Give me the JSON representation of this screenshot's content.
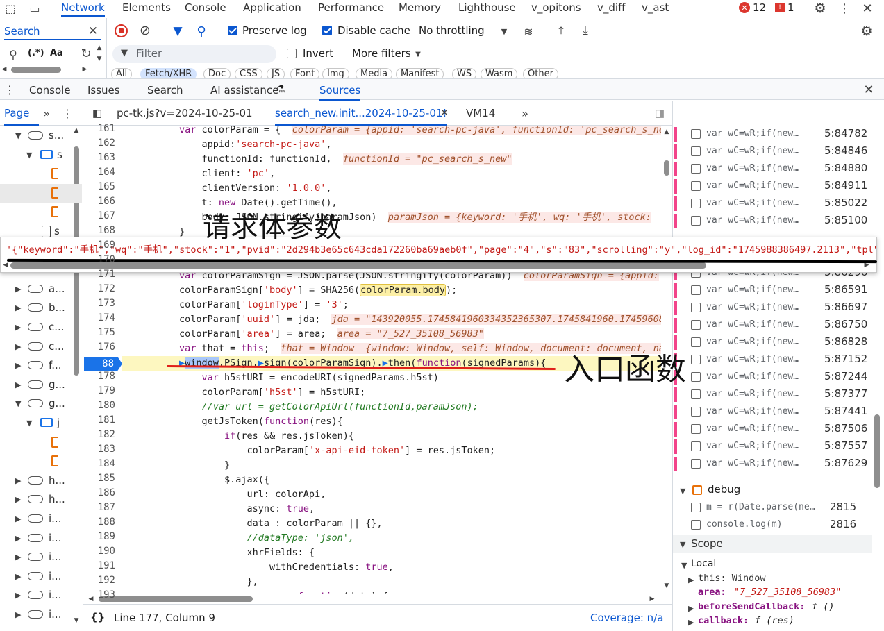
{
  "top_tabs": [
    "Network",
    "Elements",
    "Console",
    "Application",
    "Performance",
    "Memory",
    "Lighthouse",
    "v_opitons",
    "v_diff",
    "v_ast"
  ],
  "top_active": "Network",
  "error_count": "12",
  "warning_count": "1",
  "search_tab": "Search",
  "regex_label": "(.*)",
  "case_label": "Aa",
  "network": {
    "preserve_log": "Preserve log",
    "disable_cache": "Disable cache",
    "throttling": "No throttling",
    "filter_placeholder": "Filter",
    "invert": "Invert",
    "more_filters": "More filters",
    "pills": [
      "All",
      "Fetch/XHR",
      "Doc",
      "CSS",
      "JS",
      "Font",
      "Img",
      "Media",
      "Manifest",
      "WS",
      "Wasm",
      "Other"
    ]
  },
  "drawer_tabs": [
    "Console",
    "Issues",
    "Search",
    "AI assistance",
    "Sources"
  ],
  "drawer_active": "Sources",
  "nav_label": "Page",
  "file_tabs": [
    "pc-tk.js?v=2024-10-25-01",
    "search_new.init...2024-10-25-01!",
    "VM14"
  ],
  "file_active": "search_new.init...2024-10-25-01!",
  "nav_items": [
    {
      "label": "s...",
      "kind": "cloud",
      "open": true
    },
    {
      "label": "s",
      "kind": "folder",
      "open": true
    },
    {
      "label": "",
      "kind": "file"
    },
    {
      "label": "",
      "kind": "file"
    },
    {
      "label": "",
      "kind": "file"
    },
    {
      "label": "s",
      "kind": "page"
    },
    {
      "label": "",
      "kind": "hidden"
    },
    {
      "label": "",
      "kind": "hidden"
    },
    {
      "label": "a...",
      "kind": "cloud"
    },
    {
      "label": "b...",
      "kind": "cloud"
    },
    {
      "label": "c...",
      "kind": "cloud"
    },
    {
      "label": "c...",
      "kind": "cloud"
    },
    {
      "label": "f...",
      "kind": "cloud"
    },
    {
      "label": "g...",
      "kind": "cloud"
    },
    {
      "label": "g...",
      "kind": "cloud",
      "open": true
    },
    {
      "label": "j",
      "kind": "folder",
      "open": true
    },
    {
      "label": "",
      "kind": "file"
    },
    {
      "label": "",
      "kind": "file"
    },
    {
      "label": "h...",
      "kind": "cloud"
    },
    {
      "label": "h...",
      "kind": "cloud"
    },
    {
      "label": "i...",
      "kind": "cloud"
    },
    {
      "label": "i...",
      "kind": "cloud"
    },
    {
      "label": "i...",
      "kind": "cloud"
    },
    {
      "label": "i...",
      "kind": "cloud"
    },
    {
      "label": "i...",
      "kind": "cloud"
    },
    {
      "label": "i...",
      "kind": "cloud"
    }
  ],
  "code_lines": [
    {
      "num": "161",
      "html": "<span class=\"kw\">var</span> colorParam = {  <span class=\"inl\">colorParam = {appid: 'search-pc-java', functionId: 'pc_search_s_ne</span>"
    },
    {
      "num": "162",
      "html": "    appid:<span class=\"str\">'search-pc-java'</span>,"
    },
    {
      "num": "163",
      "html": "    functionId: functionId,  <span class=\"inl\">functionId = \"pc_search_s_new\"</span>"
    },
    {
      "num": "164",
      "html": "    client: <span class=\"str\">'pc'</span>,"
    },
    {
      "num": "165",
      "html": "    clientVersion: <span class=\"str\">'1.0.0'</span>,"
    },
    {
      "num": "166",
      "html": "    t: <span class=\"kw\">new</span> Date().getTime(),"
    },
    {
      "num": "167",
      "html": "    body: JSON.stringify(paramJson)  <span class=\"inl\">paramJson = {keyword: '手机', wq: '手机', stock:</span>"
    },
    {
      "num": "168",
      "html": "}"
    },
    {
      "num": "169",
      "html": ""
    },
    {
      "num": "170",
      "html": ""
    },
    {
      "num": "171",
      "html": "<span class=\"kw\">var</span> colorParamSign = JSON.parse(JSON.stringify(colorParam))  <span class=\"inl\">colorParamSign = {appid:</span>"
    },
    {
      "num": "172",
      "html": "colorParamSign[<span class=\"str\">'body'</span>] = SHA256(<span style=\"background:#fdf0a6;border:1px solid #e0c040;border-radius:3px\">colorParam.body</span>);"
    },
    {
      "num": "173",
      "html": "colorParam[<span class=\"str\">'loginType'</span>] = <span class=\"str\">'3'</span>;"
    },
    {
      "num": "174",
      "html": "colorParam[<span class=\"str\">'uuid'</span>] = jda;  <span class=\"inl\">jda = \"143920055.1745841960334352365307.1745841960.17459608</span>"
    },
    {
      "num": "175",
      "html": "colorParam[<span class=\"str\">'area'</span>] = area;  <span class=\"inl\">area = \"7_527_35108_56983\"</span>"
    },
    {
      "num": "176",
      "html": "<span class=\"kw\">var</span> that = <span class=\"kw\">this</span>;  <span class=\"inl\">that = Window  {window: Window, self: Window, document: document, na</span>"
    },
    {
      "num": "88",
      "html": "<span style=\"color:#1a73e8\">▶</span><span style=\"background:#a8c7fa\">window</span>.PSign.<span style=\"color:#1a73e8\">▶</span>sign(colorParamSign).<span style=\"color:#1a73e8\">▶</span>then(<span class=\"kw\">function</span>(signedParams){",
      "hl": true
    },
    {
      "num": "178",
      "html": "    <span class=\"kw\">var</span> h5stURI = encodeURI(signedParams.h5st)"
    },
    {
      "num": "179",
      "html": "    colorParam[<span class=\"str\">'h5st'</span>] = h5stURI;"
    },
    {
      "num": "180",
      "html": "    <span class=\"cm\">//var url = getColorApiUrl(functionId,paramJson);</span>"
    },
    {
      "num": "181",
      "html": "    getJsToken(<span class=\"kw\">function</span>(res){"
    },
    {
      "num": "182",
      "html": "        <span class=\"kw\">if</span>(res &amp;&amp; res.jsToken){"
    },
    {
      "num": "183",
      "html": "            colorParam[<span class=\"str\">'x-api-eid-token'</span>] = res.jsToken;"
    },
    {
      "num": "184",
      "html": "        }"
    },
    {
      "num": "185",
      "html": "        $.ajax({"
    },
    {
      "num": "186",
      "html": "            url: colorApi,"
    },
    {
      "num": "187",
      "html": "            async: <span class=\"kw\">true</span>,"
    },
    {
      "num": "188",
      "html": "            data : colorParam || {},"
    },
    {
      "num": "189",
      "html": "            <span class=\"cm\">//dataType: 'json',</span>"
    },
    {
      "num": "190",
      "html": "            xhrFields: {"
    },
    {
      "num": "191",
      "html": "                withCredentials: <span class=\"kw\">true</span>,"
    },
    {
      "num": "192",
      "html": "            },"
    },
    {
      "num": "193",
      "html": "            success: <span class=\"kw\">function</span>(data) {"
    }
  ],
  "tooltip_text": "'{\"keyword\":\"手机\",\"wq\":\"手机\",\"stock\":\"1\",\"pvid\":\"2d294b3e65c643cda172260ba69aeb0f\",\"page\":\"4\",\"s\":\"83\",\"scrolling\":\"y\",\"log_id\":\"1745988386497.2113\",\"tpl\"",
  "annotation_body": "请求体参数",
  "annotation_entry": "入口函数",
  "status_text": "Line 177, Column 9",
  "coverage": "Coverage: n/a",
  "breakpoints": [
    {
      "text": "var wC=wR;if(new…",
      "loc": "5:84782"
    },
    {
      "text": "var wC=wR;if(new…",
      "loc": "5:84846"
    },
    {
      "text": "var wC=wR;if(new…",
      "loc": "5:84880"
    },
    {
      "text": "var wC=wR;if(new…",
      "loc": "5:84911"
    },
    {
      "text": "var wC=wR;if(new…",
      "loc": "5:85022"
    },
    {
      "text": "var wC=wR;if(new…",
      "loc": "5:85100"
    },
    {
      "text": "",
      "loc": ""
    },
    {
      "text": "",
      "loc": ""
    },
    {
      "text": "var wC=wR;if(new…",
      "loc": "5:86296"
    },
    {
      "text": "var wC=wR;if(new…",
      "loc": "5:86591"
    },
    {
      "text": "var wC=wR;if(new…",
      "loc": "5:86697"
    },
    {
      "text": "var wC=wR;if(new…",
      "loc": "5:86750"
    },
    {
      "text": "var wC=wR;if(new…",
      "loc": "5:86828"
    },
    {
      "text": "var wC=wR;if(new…",
      "loc": "5:87152"
    },
    {
      "text": "var wC=wR;if(new…",
      "loc": "5:87244"
    },
    {
      "text": "var wC=wR;if(new…",
      "loc": "5:87377"
    },
    {
      "text": "var wC=wR;if(new…",
      "loc": "5:87441"
    },
    {
      "text": "var wC=wR;if(new…",
      "loc": "5:87506"
    },
    {
      "text": "var wC=wR;if(new…",
      "loc": "5:87557"
    },
    {
      "text": "var wC=wR;if(new…",
      "loc": "5:87629"
    }
  ],
  "debug_group": "debug",
  "debug_items": [
    {
      "text": "m = r(Date.parse(ne…",
      "loc": "2815"
    },
    {
      "text": "console.log(m)",
      "loc": "2816"
    }
  ],
  "scope_title": "Scope",
  "scope_local": "Local",
  "scope_this": "this: Window",
  "scope_area_key": "area:",
  "scope_area_val": "\"7_527_35108_56983\"",
  "scope_before_key": "beforeSendCallback:",
  "scope_before_val": "f ()",
  "scope_cb_key": "callback:",
  "scope_cb_val": "f (res)"
}
